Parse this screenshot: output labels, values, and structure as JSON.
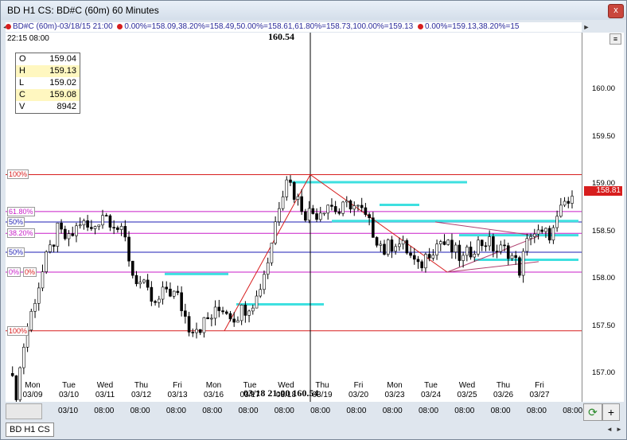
{
  "window": {
    "title": "BD H1 CS: BD#C (60m) 60 Minutes",
    "close_label": "x"
  },
  "infobar": {
    "items": [
      {
        "color": "#d71e1e",
        "text": "BD#C (60m)-03/18/15 21:00"
      },
      {
        "color": "#d71e1e",
        "text": "0.00%=158.09,38.20%=158.49,50.00%=158.61,61.80%=158.73,100.00%=159.13"
      },
      {
        "color": "#d71e1e",
        "text": "0.00%=159.13,38.20%=15"
      }
    ],
    "left_arrow": "◄",
    "right_arrow": "►"
  },
  "header": {
    "time": "22:15   08:00",
    "cursor_price": "160.54"
  },
  "ohlc": [
    {
      "key": "O",
      "value": "159.04",
      "highlight": false
    },
    {
      "key": "H",
      "value": "159.13",
      "highlight": true
    },
    {
      "key": "L",
      "value": "159.02",
      "highlight": false
    },
    {
      "key": "C",
      "value": "159.08",
      "highlight": true
    },
    {
      "key": "V",
      "value": "8942",
      "highlight": false
    }
  ],
  "price_axis": {
    "ticks": [
      "160.00",
      "159.50",
      "159.00",
      "158.50",
      "158.00",
      "157.50",
      "157.00"
    ],
    "current": "158.81",
    "zoom_label": "≡"
  },
  "fib_labels": [
    "100%",
    "61.80%",
    "50%",
    "38.20%",
    "50%",
    "0%",
    "0%",
    "100%"
  ],
  "days": [
    {
      "day": "Mon",
      "date": "03/09"
    },
    {
      "day": "Tue",
      "date": "03/10"
    },
    {
      "day": "Wed",
      "date": "03/11"
    },
    {
      "day": "Thu",
      "date": "03/12"
    },
    {
      "day": "Fri",
      "date": "03/13"
    },
    {
      "day": "Mon",
      "date": "03/16"
    },
    {
      "day": "Tue",
      "date": "03/17"
    },
    {
      "day": "Wed",
      "date": "03/18"
    },
    {
      "day": "Thu",
      "date": "03/19"
    },
    {
      "day": "Fri",
      "date": "03/20"
    },
    {
      "day": "Mon",
      "date": "03/23"
    },
    {
      "day": "Tue",
      "date": "03/24"
    },
    {
      "day": "Wed",
      "date": "03/25"
    },
    {
      "day": "Thu",
      "date": "03/26"
    },
    {
      "day": "Fri",
      "date": "03/27"
    }
  ],
  "cursor_date": "03/18 21:00  160.54",
  "time_axis": {
    "labels": [
      "03/10",
      "08:00",
      "08:00",
      "08:00",
      "08:00",
      "08:00",
      "08:00",
      "08:00",
      "08:00",
      "08:00",
      "08:00",
      "08:00",
      "08:00",
      "08:00",
      "08:00"
    ]
  },
  "buttons": {
    "refresh": "⟳",
    "plus": "+"
  },
  "tabs": [
    {
      "label": "BD H1 CS"
    }
  ],
  "tab_nav": {
    "left": "◄",
    "right": "►"
  },
  "colors": {
    "up": "#000000",
    "down": "#000000",
    "fib_red": "#d71e1e",
    "fib_magenta": "#c81ec8",
    "fib_blue": "#1e1eb4",
    "cyan": "#3ee0e0"
  },
  "chart_data": {
    "type": "candlestick",
    "ylim": [
      156.7,
      160.6
    ],
    "levels": [
      {
        "label": "100%",
        "value": 159.1,
        "color": "#d71e1e"
      },
      {
        "label": "61.80%",
        "value": 158.71,
        "color": "#c81ec8"
      },
      {
        "label": "50%",
        "value": 158.6,
        "color": "#1e1eb4"
      },
      {
        "label": "38.20%",
        "value": 158.48,
        "color": "#c81ec8"
      },
      {
        "label": "50%",
        "value": 158.28,
        "color": "#1e1eb4"
      },
      {
        "label": "0%",
        "value": 158.07,
        "color": "#c81ec8"
      },
      {
        "label": "100%",
        "value": 157.45,
        "color": "#d71e1e"
      }
    ],
    "path": [
      [
        0,
        157.0
      ],
      [
        2,
        156.8
      ],
      [
        4,
        157.3
      ],
      [
        7,
        157.8
      ],
      [
        10,
        158.2
      ],
      [
        13,
        158.5
      ],
      [
        16,
        158.4
      ],
      [
        19,
        158.6
      ],
      [
        22,
        158.5
      ],
      [
        25,
        158.7
      ],
      [
        28,
        158.6
      ],
      [
        31,
        158.4
      ],
      [
        33,
        158.05
      ],
      [
        36,
        157.9
      ],
      [
        39,
        157.7
      ],
      [
        42,
        157.9
      ],
      [
        45,
        157.8
      ],
      [
        48,
        157.5
      ],
      [
        51,
        157.5
      ],
      [
        54,
        157.6
      ],
      [
        57,
        157.7
      ],
      [
        60,
        157.6
      ],
      [
        63,
        157.7
      ],
      [
        66,
        157.8
      ],
      [
        69,
        158.2
      ],
      [
        72,
        158.8
      ],
      [
        74,
        159.1
      ],
      [
        76,
        158.9
      ],
      [
        79,
        158.7
      ],
      [
        82,
        158.7
      ],
      [
        85,
        158.8
      ],
      [
        88,
        158.7
      ],
      [
        91,
        158.8
      ],
      [
        94,
        158.7
      ],
      [
        97,
        158.5
      ],
      [
        100,
        158.3
      ],
      [
        103,
        158.4
      ],
      [
        106,
        158.3
      ],
      [
        109,
        158.1
      ],
      [
        112,
        158.3
      ],
      [
        115,
        158.4
      ],
      [
        118,
        158.3
      ],
      [
        121,
        158.2
      ],
      [
        124,
        158.35
      ],
      [
        127,
        158.4
      ],
      [
        130,
        158.3
      ],
      [
        133,
        158.3
      ],
      [
        136,
        158.1
      ],
      [
        139,
        158.5
      ],
      [
        142,
        158.45
      ],
      [
        145,
        158.5
      ],
      [
        148,
        158.8
      ],
      [
        150,
        158.8
      ]
    ]
  }
}
